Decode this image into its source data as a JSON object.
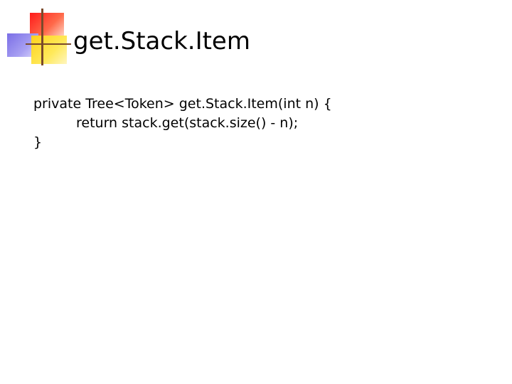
{
  "slide": {
    "title": "get.Stack.Item",
    "code_lines": [
      "private Tree<Token> get.Stack.Item(int n) {",
      "return stack.get(stack.size() - n);",
      "}"
    ]
  }
}
